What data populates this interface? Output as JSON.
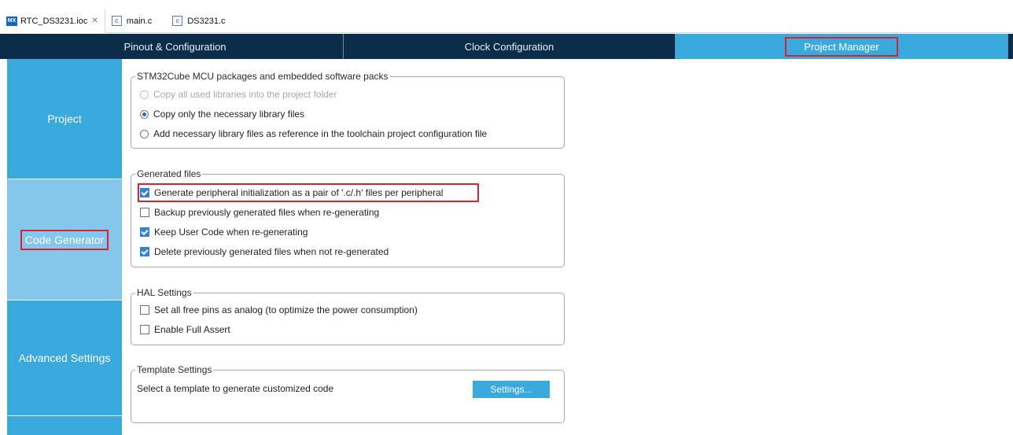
{
  "file_tabs": [
    {
      "icon": "mx-file-icon",
      "icon_text": "MX",
      "label": "RTC_DS3231.ioc",
      "close": "✕",
      "active": true
    },
    {
      "icon": "c-file-icon",
      "icon_text": "c",
      "label": "main.c",
      "active": false
    },
    {
      "icon": "c-file-icon",
      "icon_text": "c",
      "label": "DS3231.c",
      "active": false
    }
  ],
  "nav": {
    "pinout": "Pinout & Configuration",
    "clock": "Clock Configuration",
    "project_manager": "Project Manager"
  },
  "sidebar": {
    "items": [
      {
        "label": "Project"
      },
      {
        "label": "Code Generator"
      },
      {
        "label": "Advanced Settings"
      }
    ]
  },
  "packages": {
    "legend": "STM32Cube MCU packages and embedded software packs",
    "options": [
      {
        "label": "Copy all used libraries into the project folder",
        "selected": false,
        "disabled": true
      },
      {
        "label": "Copy only the necessary library files",
        "selected": true,
        "disabled": false
      },
      {
        "label": "Add necessary library files as reference in the toolchain project configuration file",
        "selected": false,
        "disabled": false
      }
    ]
  },
  "generated": {
    "legend": "Generated files",
    "options": [
      {
        "label": "Generate peripheral initialization as a pair of '.c/.h' files per peripheral",
        "checked": true
      },
      {
        "label": "Backup previously generated files when re-generating",
        "checked": false
      },
      {
        "label": "Keep User Code when re-generating",
        "checked": true
      },
      {
        "label": "Delete previously generated files when not re-generated",
        "checked": true
      }
    ]
  },
  "hal": {
    "legend": "HAL Settings",
    "options": [
      {
        "label": "Set all free pins as analog (to optimize the power consumption)",
        "checked": false
      },
      {
        "label": "Enable Full Assert",
        "checked": false
      }
    ]
  },
  "template": {
    "legend": "Template Settings",
    "description": "Select a template to generate customized code",
    "button": "Settings..."
  },
  "colors": {
    "nav_bg": "#0c2d4a",
    "accent": "#3aa9de",
    "selected_side": "#84c7ea",
    "highlight": "#d9232f"
  }
}
